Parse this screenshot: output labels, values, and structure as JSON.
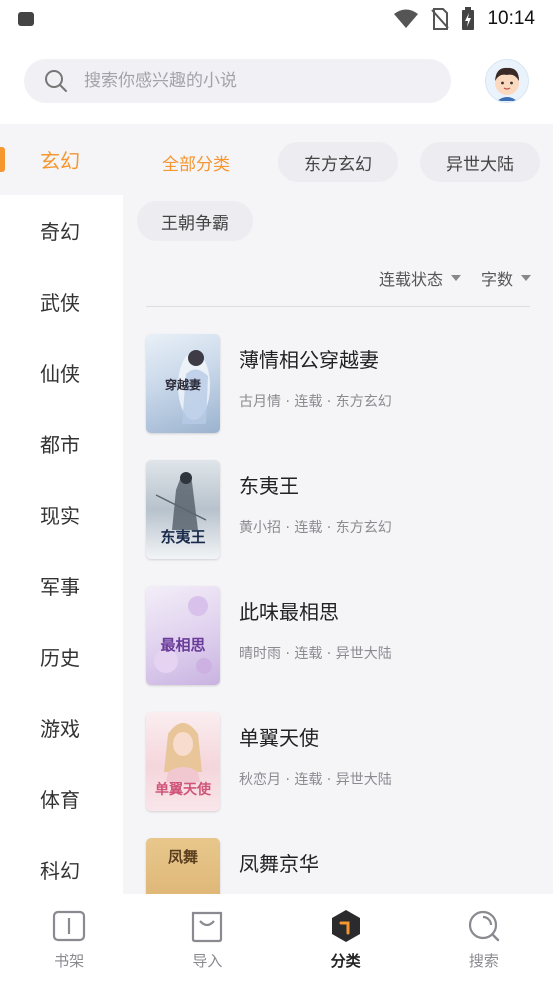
{
  "status_bar": {
    "time": "10:14"
  },
  "search": {
    "placeholder": "搜索你感兴趣的小说"
  },
  "sidebar": {
    "items": [
      {
        "label": "玄幻",
        "active": true
      },
      {
        "label": "奇幻"
      },
      {
        "label": "武侠"
      },
      {
        "label": "仙侠"
      },
      {
        "label": "都市"
      },
      {
        "label": "现实"
      },
      {
        "label": "军事"
      },
      {
        "label": "历史"
      },
      {
        "label": "游戏"
      },
      {
        "label": "体育"
      },
      {
        "label": "科幻"
      }
    ]
  },
  "subcategories": [
    {
      "label": "全部分类",
      "active": true
    },
    {
      "label": "东方玄幻"
    },
    {
      "label": "异世大陆"
    },
    {
      "label": "王朝争霸"
    }
  ],
  "filters": {
    "status_label": "连载状态",
    "words_label": "字数"
  },
  "books": [
    {
      "title": "薄情相公穿越妻",
      "meta": "古月情 · 连载 · 东方玄幻",
      "cover_text": "穿越妻"
    },
    {
      "title": "东夷王",
      "meta": "黄小招 · 连载 · 东方玄幻",
      "cover_text": "东夷王"
    },
    {
      "title": "此味最相思",
      "meta": "晴时雨 · 连载 · 异世大陆",
      "cover_text": "最相思"
    },
    {
      "title": "单翼天使",
      "meta": "秋恋月 · 连载 · 异世大陆",
      "cover_text": "单翼天使"
    },
    {
      "title": "凤舞京华",
      "meta": "",
      "cover_text": "凤舞"
    }
  ],
  "bottom_nav": {
    "items": [
      {
        "label": "书架",
        "icon": "bookshelf-icon"
      },
      {
        "label": "导入",
        "icon": "import-bag-icon"
      },
      {
        "label": "分类",
        "icon": "category-icon",
        "active": true
      },
      {
        "label": "搜索",
        "icon": "search-icon"
      }
    ]
  },
  "colors": {
    "accent": "#f5962f",
    "content_bg": "#f5f5f8",
    "chip_bg": "#ececf1"
  }
}
